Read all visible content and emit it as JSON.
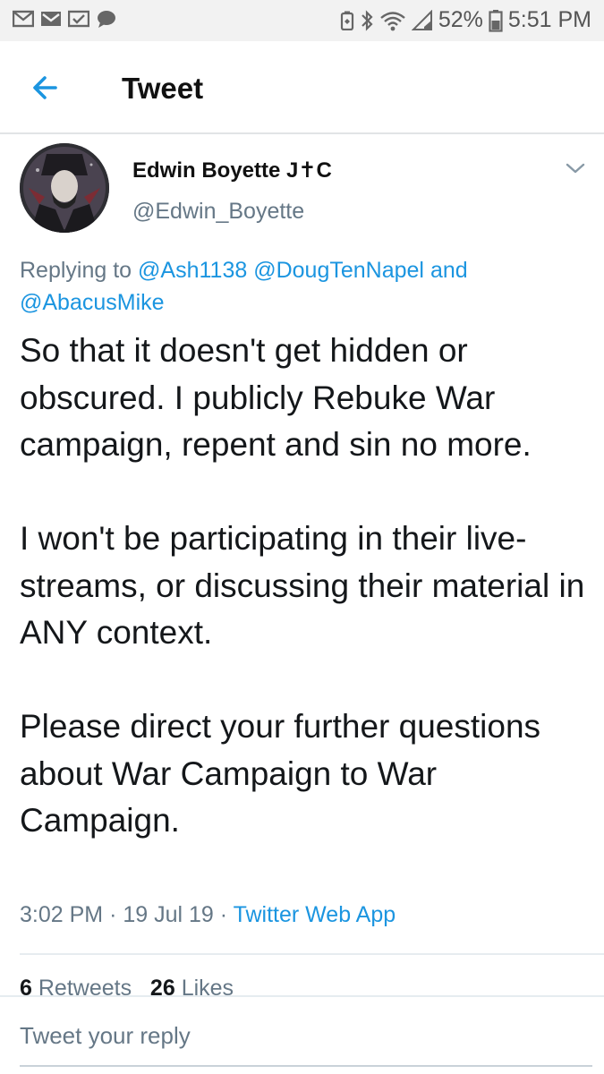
{
  "status_bar": {
    "battery": "52%",
    "time": "5:51 PM",
    "icons": [
      "mail-icon",
      "gmail-icon",
      "mail-check-icon",
      "chat-bubble-icon",
      "battery-saver-icon",
      "bluetooth-icon",
      "wifi-icon",
      "signal-icon",
      "battery-icon"
    ]
  },
  "header": {
    "title": "Tweet",
    "back_icon": "back-arrow-icon",
    "accent": "#1b95e0"
  },
  "tweet": {
    "author_name": "Edwin Boyette J✝C",
    "author_handle": "@Edwin_Boyette",
    "replying_prefix": "Replying to",
    "mentions": [
      "@Ash1138",
      "@DougTenNapel",
      "@AbacusMike"
    ],
    "replying_and": "and",
    "paragraphs": [
      "So that it doesn't get hidden or obscured. I publicly Rebuke War campaign, repent and sin no more.",
      "I won't be participating in their live-streams, or discussing their material in ANY context.",
      "Please direct your further questions about War Campaign to War Campaign."
    ],
    "time": "3:02 PM",
    "date": "19 Jul 19",
    "source": "Twitter Web App",
    "separator": "·"
  },
  "stats": {
    "retweets_count": "6",
    "retweets_label": "Retweets",
    "likes_count": "26",
    "likes_label": "Likes"
  },
  "reply": {
    "placeholder": "Tweet your reply"
  }
}
